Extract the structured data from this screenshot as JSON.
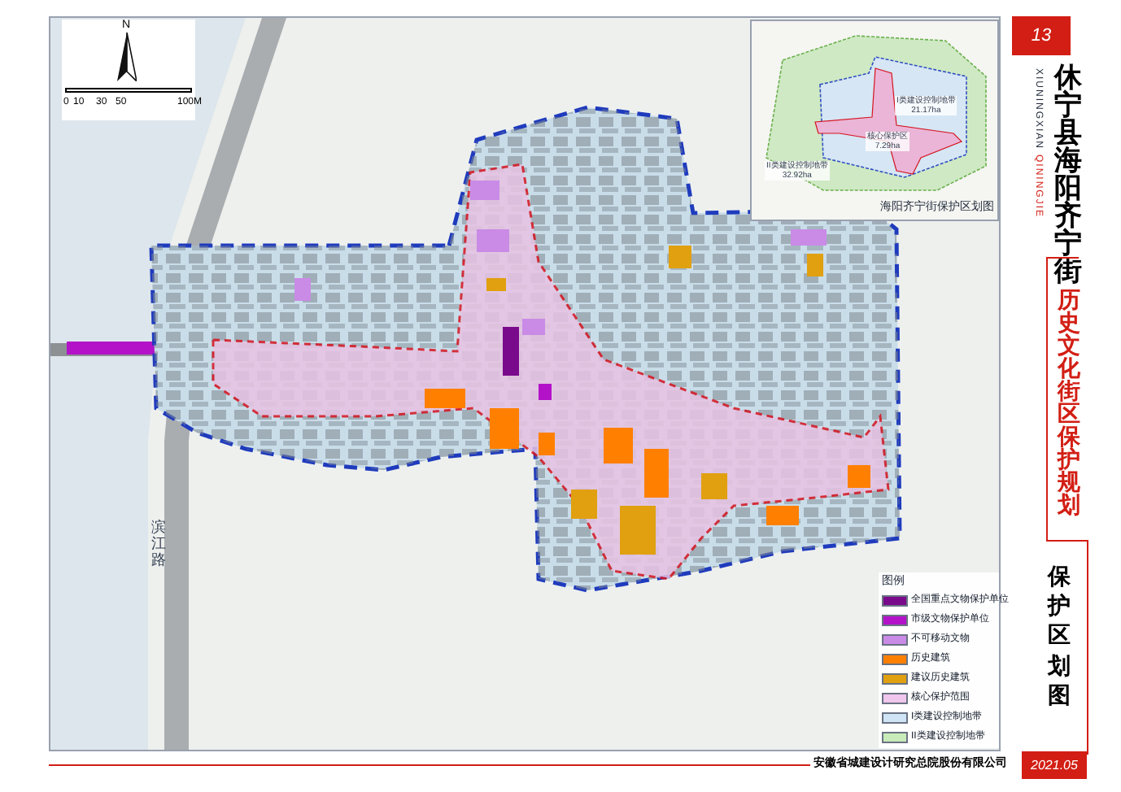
{
  "scale_bar": {
    "north": "N",
    "ticks": [
      "0",
      "10",
      "30",
      "50",
      "100M"
    ]
  },
  "map": {
    "road_labels": [
      "滨江路"
    ]
  },
  "inset": {
    "zones": [
      {
        "name": "I类建设控制地带",
        "area": "21.17ha"
      },
      {
        "name": "核心保护区",
        "area": "7.29ha"
      },
      {
        "name": "II类建设控制地带",
        "area": "32.92ha"
      }
    ],
    "caption": "海阳齐宁街保护区划图"
  },
  "legend": {
    "title": "图例",
    "items": [
      {
        "label": "全国重点文物保护单位",
        "color": "#7a0a8c"
      },
      {
        "label": "市级文物保护单位",
        "color": "#b312c9"
      },
      {
        "label": "不可移动文物",
        "color": "#c98be6"
      },
      {
        "label": "历史建筑",
        "color": "#ff8000"
      },
      {
        "label": "建议历史建筑",
        "color": "#e0a010"
      },
      {
        "label": "核心保护范围",
        "color": "#efc6ec"
      },
      {
        "label": "I类建设控制地带",
        "color": "#cfe4f5"
      },
      {
        "label": "II类建设控制地带",
        "color": "#c8ebb9"
      }
    ]
  },
  "title_column": {
    "page_number": "13",
    "pinyin": [
      "XIUNINGXIAN",
      "QININGJIE"
    ],
    "title": "休宁县海阳齐宁街",
    "subtitle": "历史文化街区保护规划",
    "sheet": "保护区划图"
  },
  "footer": {
    "company": "安徽省城建设计研究总院股份有限公司",
    "date": "2021.05"
  }
}
